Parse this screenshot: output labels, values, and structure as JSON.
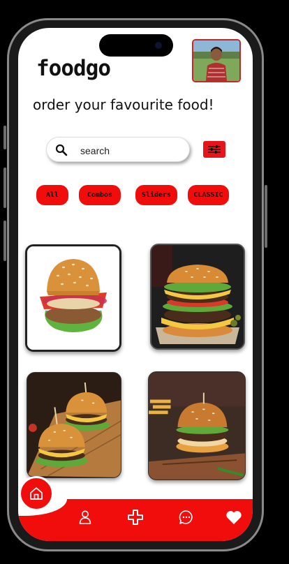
{
  "app": {
    "logo": "foodgo"
  },
  "header": {
    "tagline": "order your favourite food!"
  },
  "search": {
    "placeholder": "search"
  },
  "categories": [
    "All",
    "Combos",
    "Sliders",
    "CLASSIC"
  ],
  "colors": {
    "accent": "#f20d0d",
    "background": "#ffffff",
    "frame": "#8a8a8a"
  },
  "icons": {
    "search": "search-icon",
    "filter": "sliders-icon",
    "home": "home-icon",
    "profile": "person-icon",
    "add": "plus-icon",
    "chat": "chat-bubble-icon",
    "favorites": "heart-icon"
  },
  "products": [
    {
      "image": "classic-burger-white-background"
    },
    {
      "image": "double-cheeseburger-dark-background"
    },
    {
      "image": "sliders-on-wooden-board"
    },
    {
      "image": "gourmet-burger-on-board"
    }
  ]
}
